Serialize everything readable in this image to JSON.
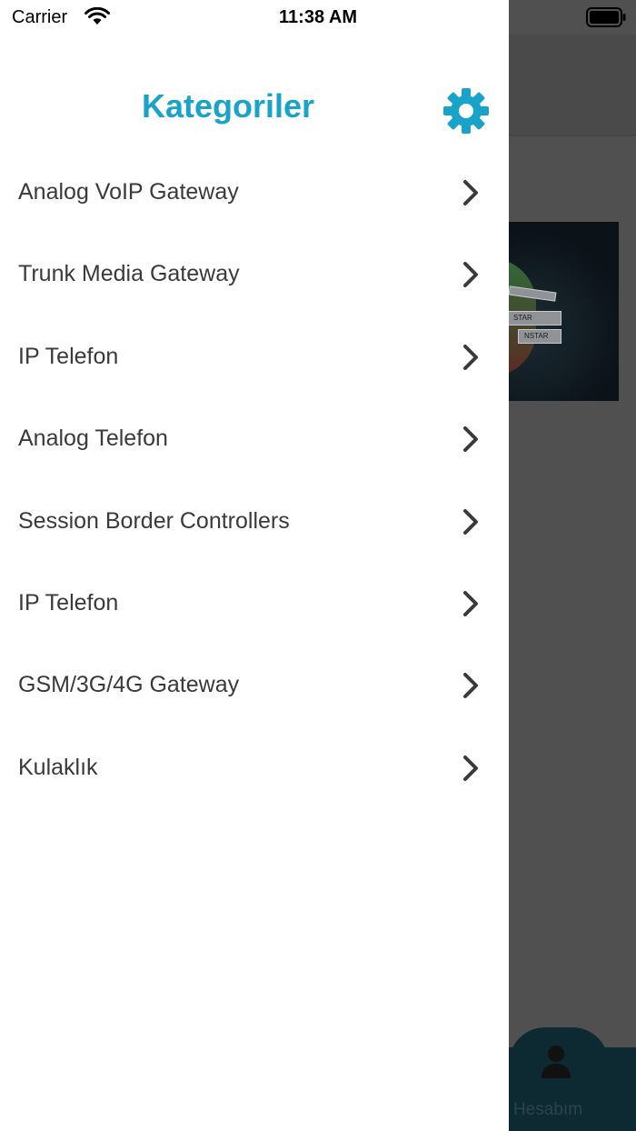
{
  "status_bar": {
    "carrier": "Carrier",
    "time": "11:38 AM"
  },
  "drawer": {
    "title": "Kategoriler",
    "title_color": "#1aa3c9",
    "settings_icon": "gear-icon",
    "items": [
      {
        "label": "Analog VoIP Gateway"
      },
      {
        "label": "Trunk Media Gateway"
      },
      {
        "label": "IP Telefon"
      },
      {
        "label": "Analog Telefon"
      },
      {
        "label": "Session Border Controllers"
      },
      {
        "label": "IP Telefon"
      },
      {
        "label": "GSM/3G/4G Gateway"
      },
      {
        "label": "Kulaklık"
      }
    ],
    "item_icon": "chevron-right-icon"
  },
  "background": {
    "banner_texts": [
      "STAR",
      "NSTAR"
    ],
    "tab_bar": {
      "account_label": "Hesabım",
      "account_icon": "user-icon",
      "color": "#0d2a32"
    }
  }
}
